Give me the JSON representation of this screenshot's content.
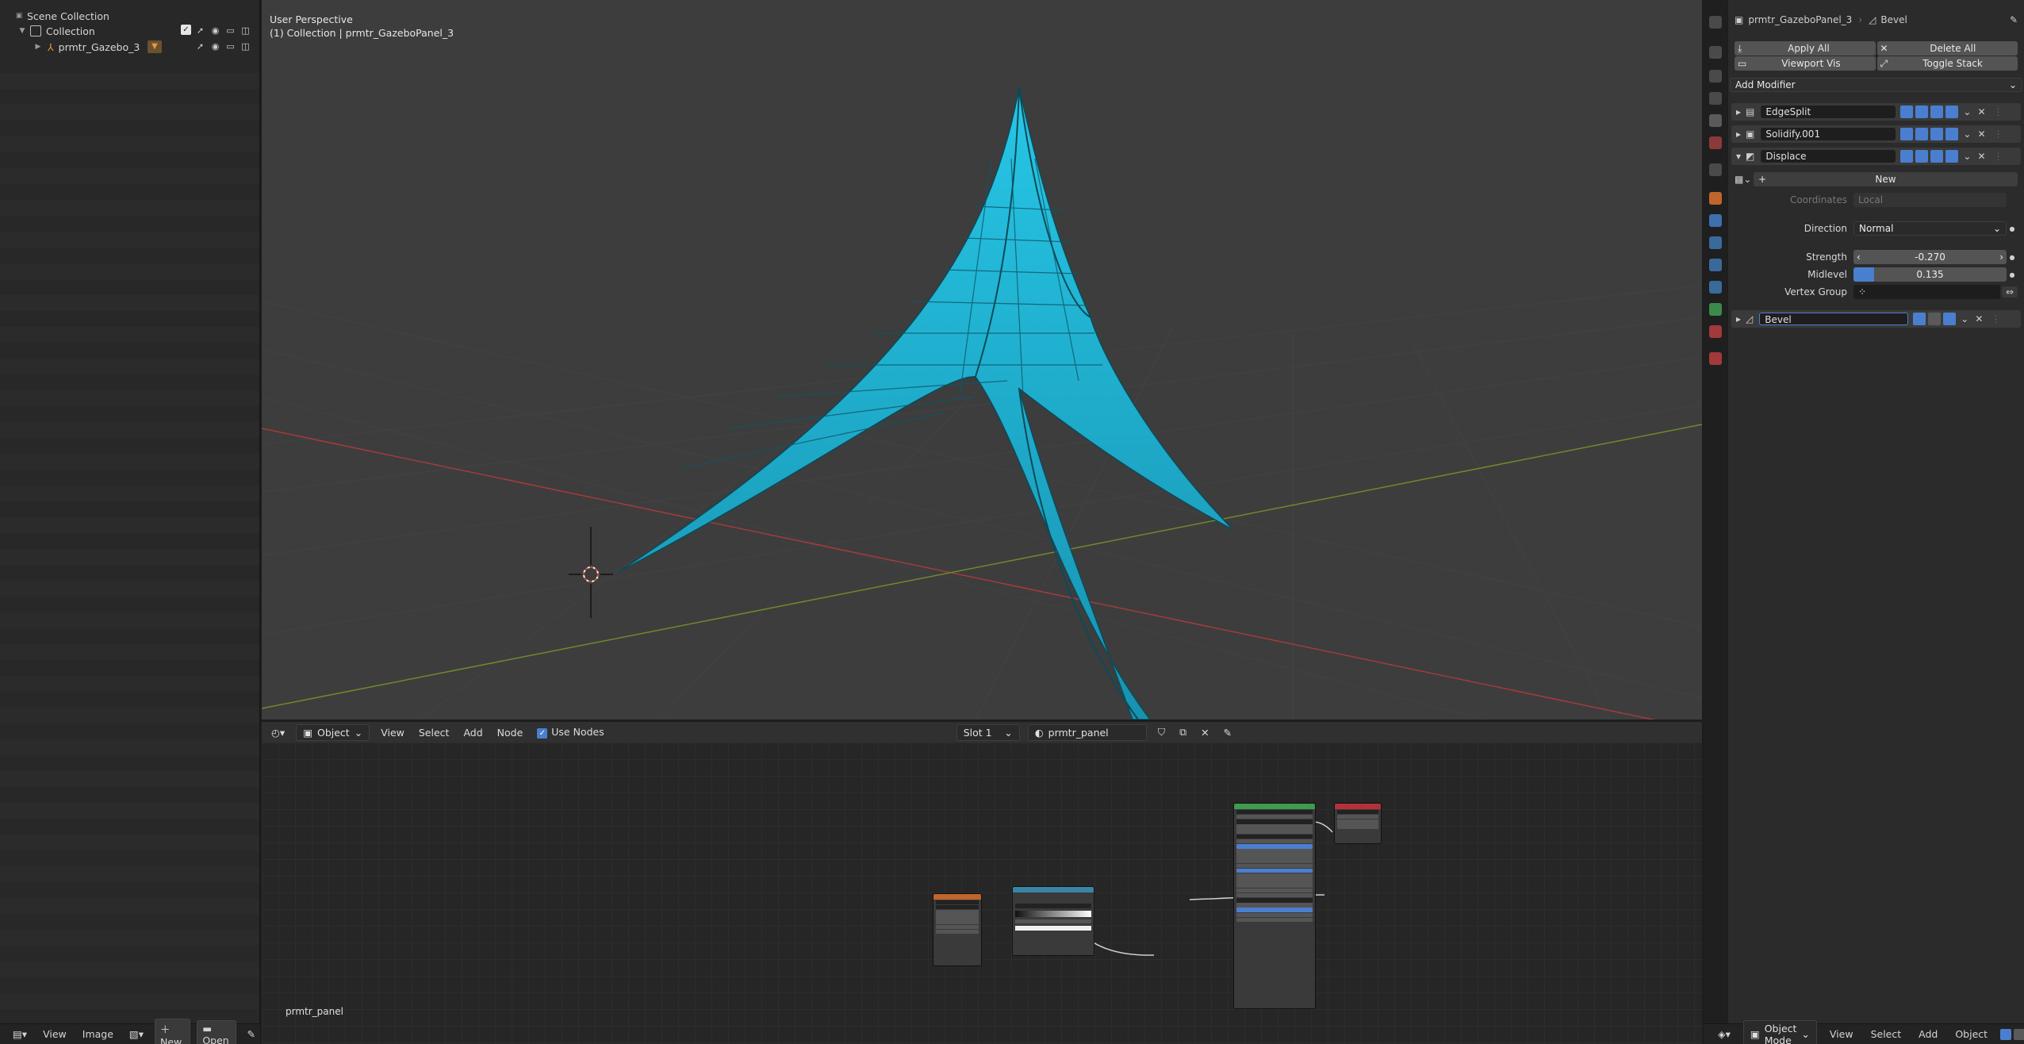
{
  "outliner": {
    "scene_collection": "Scene Collection",
    "collection": "Collection",
    "object": "prmtr_Gazebo_3"
  },
  "left_bottom": {
    "view": "View",
    "image": "Image",
    "new": "New",
    "open": "Open"
  },
  "viewport": {
    "perspective": "User Perspective",
    "context": "(1) Collection | prmtr_GazeboPanel_3"
  },
  "node_header": {
    "object_mode": "Object",
    "menus": [
      "View",
      "Select",
      "Add",
      "Node"
    ],
    "use_nodes": "Use Nodes",
    "slot": "Slot 1",
    "material": "prmtr_panel"
  },
  "node_editor": {
    "material_name": "prmtr_panel"
  },
  "properties": {
    "object_name": "prmtr_GazeboPanel_3",
    "modifier_name": "Bevel",
    "apply_all": "Apply All",
    "delete_all": "Delete All",
    "viewport_vis": "Viewport Vis",
    "toggle_stack": "Toggle Stack",
    "add_modifier": "Add Modifier",
    "modifiers": [
      "EdgeSplit",
      "Solidify.001",
      "Displace",
      "Bevel"
    ],
    "displace": {
      "new_button": "New",
      "coordinates_label": "Coordinates",
      "coordinates_value": "Local",
      "direction_label": "Direction",
      "direction_value": "Normal",
      "strength_label": "Strength",
      "strength_value": "-0.270",
      "midlevel_label": "Midlevel",
      "midlevel_value": "0.135",
      "midlevel_fraction": 0.135,
      "vertex_group_label": "Vertex Group"
    }
  },
  "right_bottom": {
    "mode": "Object Mode",
    "menus": [
      "View",
      "Select",
      "Add",
      "Object"
    ]
  },
  "colors": {
    "accent_blue": "#4a7fd0",
    "mesh_cyan": "#1fb8d8",
    "axis_red": "#c04040",
    "axis_green": "#7a9a30"
  }
}
